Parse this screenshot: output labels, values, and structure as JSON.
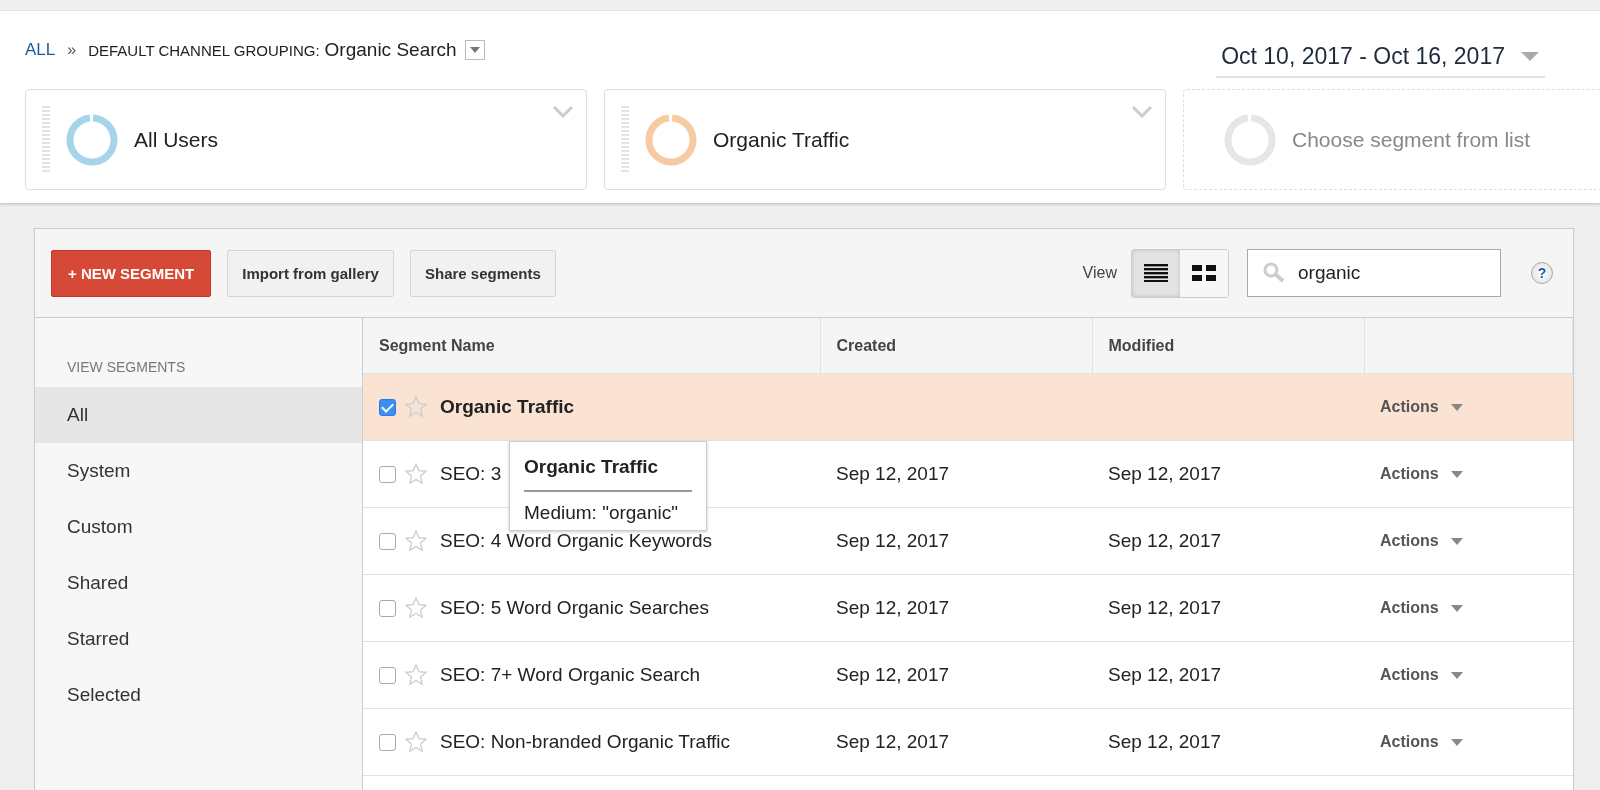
{
  "breadcrumb": {
    "root": "ALL",
    "separator": "»",
    "dimension": "DEFAULT CHANNEL GROUPING:",
    "value": "Organic Search"
  },
  "date_range": "Oct 10, 2017 - Oct 16, 2017",
  "segments": [
    {
      "kind": "active",
      "label": "All Users",
      "color": "#a6d4ea"
    },
    {
      "kind": "active",
      "label": "Organic Traffic",
      "color": "#f7cba1"
    },
    {
      "kind": "placeholder",
      "label": "Choose segment from list",
      "color": "#e6e6e6"
    }
  ],
  "toolbar": {
    "new_button": "+ NEW SEGMENT",
    "import_button": "Import from gallery",
    "share_button": "Share segments",
    "view_label": "View",
    "views": [
      {
        "kind": "list",
        "selected": true
      },
      {
        "kind": "grid",
        "selected": false
      }
    ],
    "search": {
      "value": "organic"
    },
    "help": "?"
  },
  "sidebar": {
    "heading": "VIEW SEGMENTS",
    "items": [
      {
        "label": "All",
        "selected": true
      },
      {
        "label": "System",
        "selected": false
      },
      {
        "label": "Custom",
        "selected": false
      },
      {
        "label": "Shared",
        "selected": false
      },
      {
        "label": "Starred",
        "selected": false
      },
      {
        "label": "Selected",
        "selected": false
      }
    ]
  },
  "table": {
    "columns": [
      "Segment Name",
      "Created",
      "Modified"
    ],
    "rows": [
      {
        "name": "Organic Traffic",
        "checked": true,
        "starred": false,
        "action": "Actions"
      },
      {
        "name": "SEO: 3",
        "created": "Sep 12, 2017",
        "modified": "Sep 12, 2017",
        "checked": false,
        "starred": false,
        "action": "Actions"
      },
      {
        "name": "SEO: 4 Word Organic Keywords",
        "created": "Sep 12, 2017",
        "modified": "Sep 12, 2017",
        "checked": false,
        "starred": false,
        "action": "Actions"
      },
      {
        "name": "SEO: 5 Word Organic Searches",
        "created": "Sep 12, 2017",
        "modified": "Sep 12, 2017",
        "checked": false,
        "starred": false,
        "action": "Actions"
      },
      {
        "name": "SEO: 7+ Word Organic Search",
        "created": "Sep 12, 2017",
        "modified": "Sep 12, 2017",
        "checked": false,
        "starred": false,
        "action": "Actions"
      },
      {
        "name": "SEO: Non-branded Organic Traffic",
        "created": "Sep 12, 2017",
        "modified": "Sep 12, 2017",
        "checked": false,
        "starred": false,
        "action": "Actions"
      }
    ]
  },
  "tooltip": {
    "title": "Organic Traffic",
    "body": "Medium: \"organic\""
  }
}
